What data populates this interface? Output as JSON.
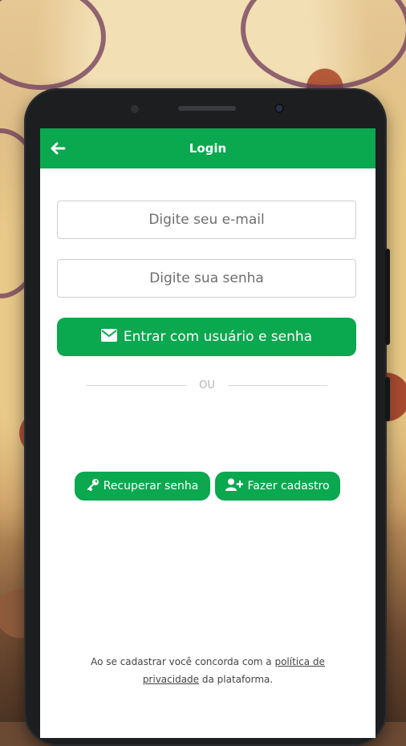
{
  "appbar": {
    "title": "Login",
    "back_icon": "arrow-left-icon"
  },
  "form": {
    "email_placeholder": "Digite seu e-mail",
    "password_placeholder": "Digite sua senha",
    "login_button_label": "Entrar com usuário e senha",
    "login_button_icon": "envelope-icon",
    "divider_text": "OU"
  },
  "actions": {
    "recover_label": "Recuperar senha",
    "recover_icon": "key-icon",
    "signup_label": "Fazer cadastro",
    "signup_icon": "user-plus-icon"
  },
  "terms": {
    "prefix": "Ao se cadastrar você concorda com a ",
    "link": "política de privacidade",
    "suffix": " da plataforma."
  },
  "colors": {
    "primary": "#0aa84f",
    "background": "#ffffff"
  }
}
